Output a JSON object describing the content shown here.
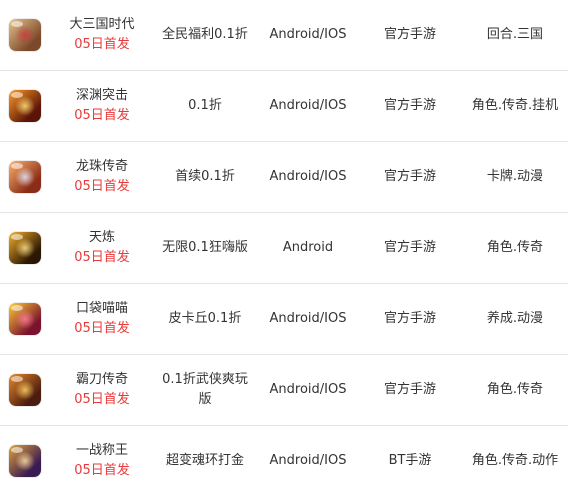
{
  "colors": {
    "release": "#e83a3a",
    "text": "#333333",
    "divider": "#e4e4e4"
  },
  "games": [
    {
      "name": "大三国时代",
      "release": "05日首发",
      "promo": "全民福利0.1折",
      "platform": "Android/IOS",
      "type": "官方手游",
      "genre": "回合.三国",
      "icon": "game-icon-warrior",
      "icon_colors": [
        "#7b4a2b",
        "#e7c38d",
        "#c83c3c"
      ]
    },
    {
      "name": "深渊突击",
      "release": "05日首发",
      "promo": "0.1折",
      "platform": "Android/IOS",
      "type": "官方手游",
      "genre": "角色.传奇.挂机",
      "icon": "game-icon-sword-fire",
      "icon_colors": [
        "#5a1408",
        "#ff9c28",
        "#ffe27a"
      ]
    },
    {
      "name": "龙珠传奇",
      "release": "05日首发",
      "promo": "首续0.1折",
      "platform": "Android/IOS",
      "type": "官方手游",
      "genre": "卡牌.动漫",
      "icon": "game-icon-anime-hero",
      "icon_colors": [
        "#8a2c18",
        "#ffb36b",
        "#e2e8ff"
      ]
    },
    {
      "name": "天炼",
      "release": "05日首发",
      "promo": "无限0.1狂嗨版",
      "platform": "Android",
      "type": "官方手游",
      "genre": "角色.传奇",
      "icon": "game-icon-gold-emblem",
      "icon_colors": [
        "#2b1704",
        "#f6b12a",
        "#ffe08a"
      ]
    },
    {
      "name": "口袋喵喵",
      "release": "05日首发",
      "promo": "皮卡丘0.1折",
      "platform": "Android/IOS",
      "type": "官方手游",
      "genre": "养成.动漫",
      "icon": "game-icon-cat",
      "icon_colors": [
        "#7a1230",
        "#ffcc33",
        "#ff7a9a"
      ]
    },
    {
      "name": "霸刀传奇",
      "release": "05日首发",
      "promo": "0.1折武侠爽玩版",
      "platform": "Android/IOS",
      "type": "官方手游",
      "genre": "角色.传奇",
      "icon": "game-icon-blade",
      "icon_colors": [
        "#4b1d10",
        "#e8892a",
        "#ffd166"
      ]
    },
    {
      "name": "一战称王",
      "release": "05日首发",
      "promo": "超变魂环打金",
      "platform": "Android/IOS",
      "type": "BT手游",
      "genre": "角色.传奇.动作",
      "icon": "game-icon-crown-warrior",
      "icon_colors": [
        "#3a1a52",
        "#e0a13a",
        "#ffe0a0"
      ]
    }
  ]
}
